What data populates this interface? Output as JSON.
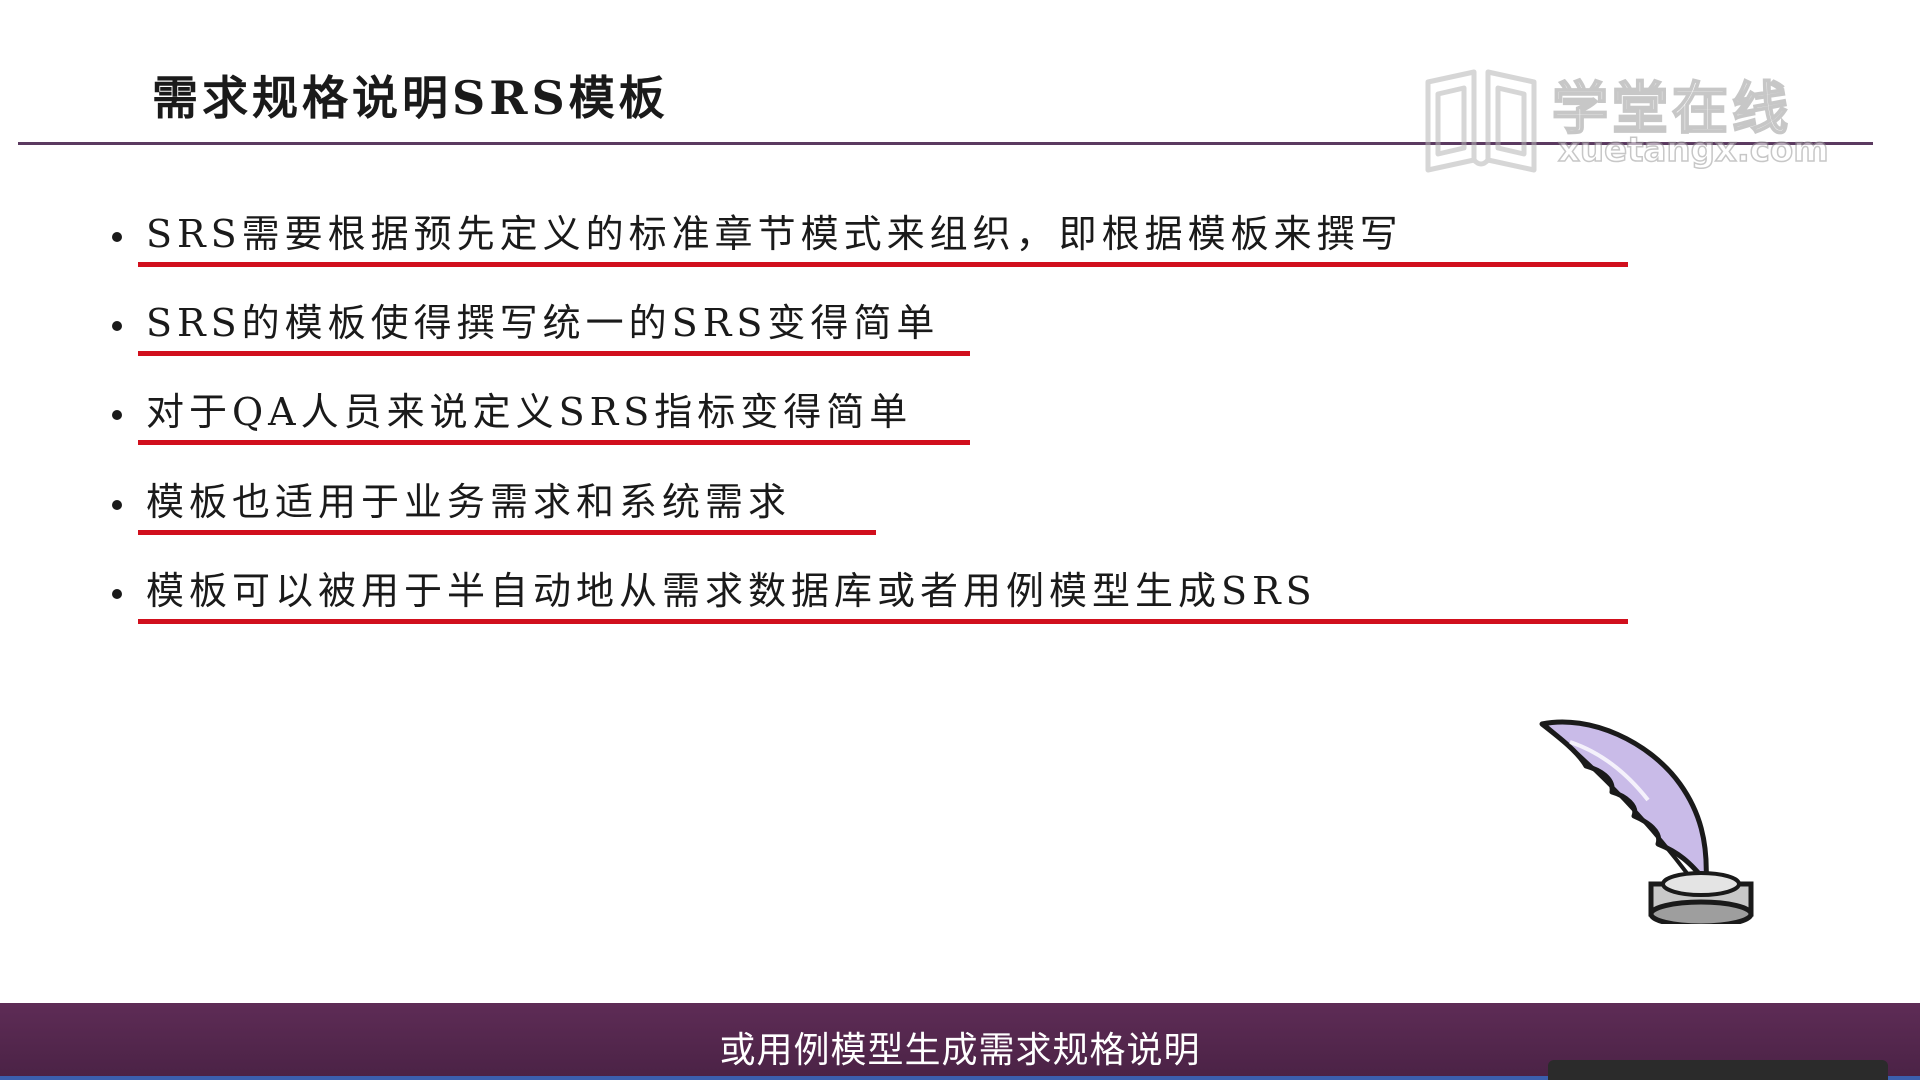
{
  "slide": {
    "title": "需求规格说明SRS模板",
    "bullets": [
      {
        "text": "SRS需要根据预先定义的标准章节模式来组织，即根据模板来撰写"
      },
      {
        "text": "SRS的模板使得撰写统一的SRS变得简单"
      },
      {
        "text": "对于QA人员来说定义SRS指标变得简单"
      },
      {
        "text": "模板也适用于业务需求和系统需求"
      },
      {
        "text": "模板可以被用于半自动地从需求数据库或者用例模型生成SRS"
      }
    ]
  },
  "watermark": {
    "name": "学堂在线",
    "url": "xuetangx.com",
    "logo_icon": "open-book-logo-icon"
  },
  "illustration": {
    "icon": "quill-inkwell-icon"
  },
  "subtitle": {
    "text": "或用例模型生成需求规格说明"
  },
  "colors": {
    "title_rule": "#5b3a60",
    "underline": "#d10f1d",
    "subtitle_bar": "#5e2c56",
    "text": "#1a1a1a"
  }
}
